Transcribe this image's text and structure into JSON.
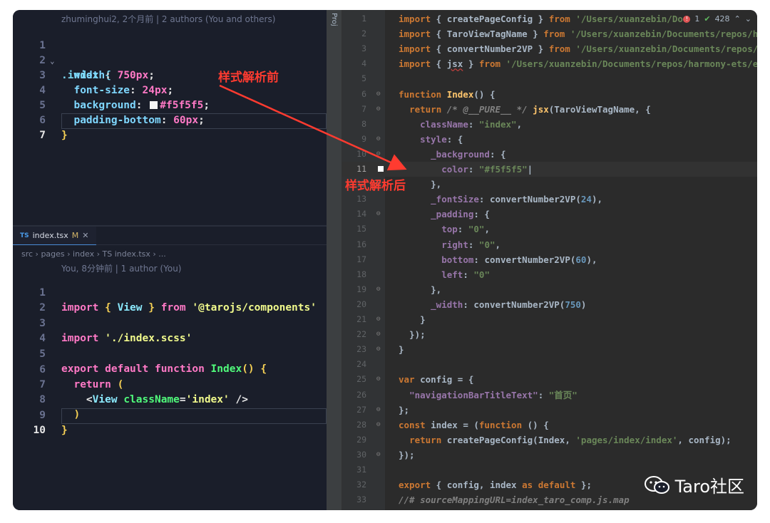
{
  "top_editor": {
    "blame": "zhuminghui2, 2个月前 | 2 authors (You and others)",
    "lines": [
      {
        "n": "1",
        "text": ".index {"
      },
      {
        "n": "2",
        "prop": "width",
        "val": "750px"
      },
      {
        "n": "3",
        "prop": "font-size",
        "val": "24px"
      },
      {
        "n": "4",
        "prop": "background",
        "val": "#f5f5f5"
      },
      {
        "n": "5",
        "prop": "padding-bottom",
        "val": "60px"
      },
      {
        "n": "6",
        "text": "}"
      },
      {
        "n": "7",
        "text": ""
      }
    ]
  },
  "bottom_editor": {
    "tab_icon": "TS",
    "tab_name": "index.tsx",
    "tab_status": "M",
    "breadcrumb": "src › pages › index › TS index.tsx › ...",
    "blame": "You, 8分钟前 | 1 author (You)",
    "line_numbers": [
      "1",
      "2",
      "3",
      "4",
      "5",
      "6",
      "7",
      "8",
      "9",
      "10"
    ],
    "line1": {
      "kw": "import",
      "name": "View",
      "from": "from",
      "path": "'@tarojs/components'"
    },
    "line3": {
      "kw": "import",
      "path": "'./index.scss'"
    },
    "line5": {
      "export": "export",
      "default": "default",
      "function": "function",
      "name": "Index"
    },
    "line6": {
      "kw": "return"
    },
    "line7": {
      "tag": "View",
      "attr": "className",
      "val": "'index'"
    }
  },
  "annotations": {
    "before": "样式解析前",
    "after": "样式解析后"
  },
  "right_editor": {
    "side_label": "Proj",
    "status": {
      "errors": "1",
      "checks": "428"
    },
    "lines": [
      {
        "n": "1"
      },
      {
        "n": "2"
      },
      {
        "n": "3"
      },
      {
        "n": "4"
      },
      {
        "n": "5"
      },
      {
        "n": "6"
      },
      {
        "n": "7"
      },
      {
        "n": "8"
      },
      {
        "n": "9"
      },
      {
        "n": "10"
      },
      {
        "n": "11"
      },
      {
        "n": "12"
      },
      {
        "n": "13"
      },
      {
        "n": "14"
      },
      {
        "n": "15"
      },
      {
        "n": "16"
      },
      {
        "n": "17"
      },
      {
        "n": "18"
      },
      {
        "n": "19"
      },
      {
        "n": "20"
      },
      {
        "n": "21"
      },
      {
        "n": "22"
      },
      {
        "n": "23"
      },
      {
        "n": "24"
      },
      {
        "n": "25"
      },
      {
        "n": "26"
      },
      {
        "n": "27"
      },
      {
        "n": "28"
      },
      {
        "n": "29"
      },
      {
        "n": "30"
      },
      {
        "n": "31"
      },
      {
        "n": "32"
      },
      {
        "n": "33"
      }
    ],
    "code": {
      "l1": {
        "name": "createPageConfig",
        "path": "'/Users/xuanzebin/Do"
      },
      "l2": {
        "name": "TaroViewTagName",
        "path": "'/Users/xuanzebin/Documents/repos/ha"
      },
      "l3": {
        "name": "convertNumber2VP",
        "path": "'/Users/xuanzebin/Documents/repos/ha"
      },
      "l4": {
        "name": "jsx",
        "path": "'/Users/xuanzebin/Documents/repos/harmony-ets/ent"
      },
      "l6": {
        "name": "Index"
      },
      "l7": {
        "comment": "/* @__PURE__ */",
        "call": "jsx",
        "arg": "TaroViewTagName"
      },
      "l8": {
        "key": "className",
        "val": "\"index\""
      },
      "l9": {
        "key": "style"
      },
      "l10": {
        "key": "_background"
      },
      "l11": {
        "key": "color",
        "val": "\"#f5f5f5\""
      },
      "l13": {
        "key": "_fontSize",
        "call": "convertNumber2VP",
        "num": "24"
      },
      "l14": {
        "key": "_padding"
      },
      "l15": {
        "key": "top",
        "val": "\"0\""
      },
      "l16": {
        "key": "right",
        "val": "\"0\""
      },
      "l17": {
        "key": "bottom",
        "call": "convertNumber2VP",
        "num": "60"
      },
      "l18": {
        "key": "left",
        "val": "\"0\""
      },
      "l20": {
        "key": "_width",
        "call": "convertNumber2VP",
        "num": "750"
      },
      "l25": {
        "name": "config"
      },
      "l26": {
        "key": "\"navigationBarTitleText\"",
        "val": "\"首页\""
      },
      "l28": {
        "name": "index",
        "fn": "function"
      },
      "l29": {
        "call": "createPageConfig",
        "a1": "Index",
        "a2": "'pages/index/index'",
        "a3": "config"
      },
      "l32": {
        "a": "config",
        "b": "index",
        "as": "as",
        "def": "default"
      },
      "l33": {
        "comment": "//# sourceMappingURL=index_taro_comp.js.map"
      }
    }
  },
  "watermark": {
    "text": "Taro社区",
    "icon": "wechat-icon"
  }
}
